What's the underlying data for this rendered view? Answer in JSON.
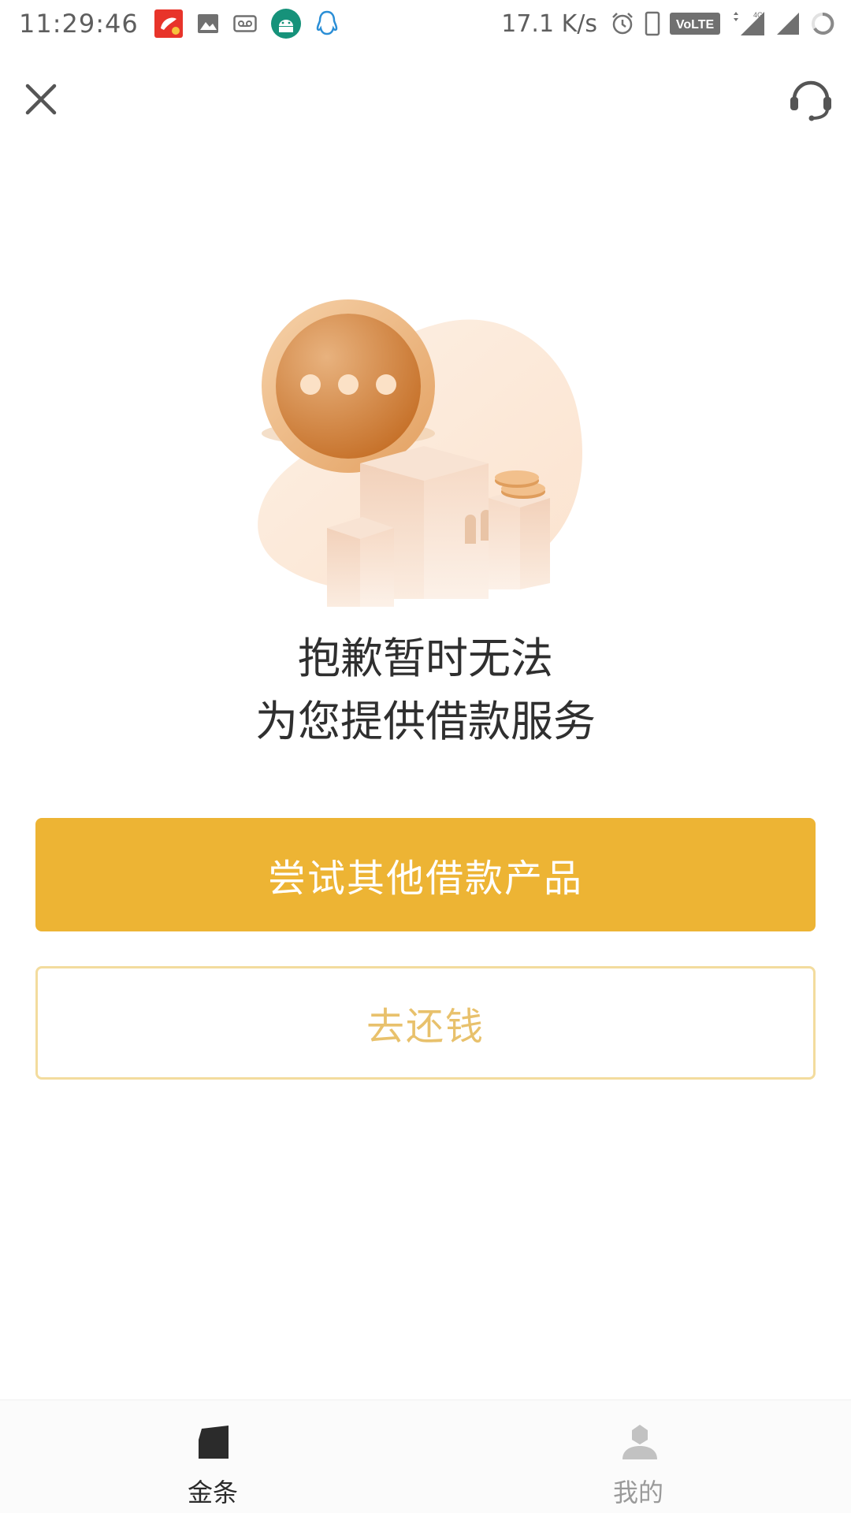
{
  "status_bar": {
    "time": "11:29:46",
    "network_speed": "17.1 K/s",
    "volte_label": "VoLTE",
    "network_type": "4G"
  },
  "nav": {
    "close_icon": "close-icon",
    "support_icon": "headset-icon"
  },
  "message": {
    "line1": "抱歉暂时无法",
    "line2": "为您提供借款服务"
  },
  "buttons": {
    "primary_label": "尝试其他借款产品",
    "secondary_label": "去还钱"
  },
  "tabs": [
    {
      "label": "金条",
      "icon": "card-icon",
      "active": true
    },
    {
      "label": "我的",
      "icon": "person-icon",
      "active": false
    }
  ],
  "colors": {
    "accent": "#edb434",
    "secondary_text": "#e8c16c",
    "secondary_border": "#f3dc9e",
    "title_text": "#2f2f2f"
  }
}
